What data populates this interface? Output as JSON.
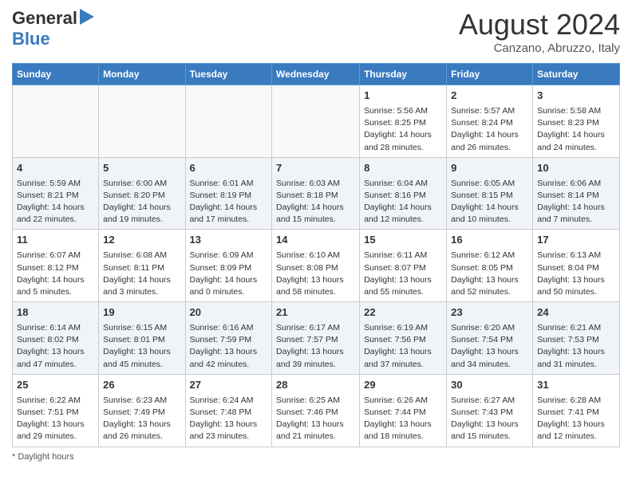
{
  "header": {
    "logo_general": "General",
    "logo_blue": "Blue",
    "month_year": "August 2024",
    "location": "Canzano, Abruzzo, Italy"
  },
  "days_of_week": [
    "Sunday",
    "Monday",
    "Tuesday",
    "Wednesday",
    "Thursday",
    "Friday",
    "Saturday"
  ],
  "weeks": [
    {
      "days": [
        {
          "num": "",
          "data": ""
        },
        {
          "num": "",
          "data": ""
        },
        {
          "num": "",
          "data": ""
        },
        {
          "num": "",
          "data": ""
        },
        {
          "num": "1",
          "data": "Sunrise: 5:56 AM\nSunset: 8:25 PM\nDaylight: 14 hours and 28 minutes."
        },
        {
          "num": "2",
          "data": "Sunrise: 5:57 AM\nSunset: 8:24 PM\nDaylight: 14 hours and 26 minutes."
        },
        {
          "num": "3",
          "data": "Sunrise: 5:58 AM\nSunset: 8:23 PM\nDaylight: 14 hours and 24 minutes."
        }
      ]
    },
    {
      "days": [
        {
          "num": "4",
          "data": "Sunrise: 5:59 AM\nSunset: 8:21 PM\nDaylight: 14 hours and 22 minutes."
        },
        {
          "num": "5",
          "data": "Sunrise: 6:00 AM\nSunset: 8:20 PM\nDaylight: 14 hours and 19 minutes."
        },
        {
          "num": "6",
          "data": "Sunrise: 6:01 AM\nSunset: 8:19 PM\nDaylight: 14 hours and 17 minutes."
        },
        {
          "num": "7",
          "data": "Sunrise: 6:03 AM\nSunset: 8:18 PM\nDaylight: 14 hours and 15 minutes."
        },
        {
          "num": "8",
          "data": "Sunrise: 6:04 AM\nSunset: 8:16 PM\nDaylight: 14 hours and 12 minutes."
        },
        {
          "num": "9",
          "data": "Sunrise: 6:05 AM\nSunset: 8:15 PM\nDaylight: 14 hours and 10 minutes."
        },
        {
          "num": "10",
          "data": "Sunrise: 6:06 AM\nSunset: 8:14 PM\nDaylight: 14 hours and 7 minutes."
        }
      ]
    },
    {
      "days": [
        {
          "num": "11",
          "data": "Sunrise: 6:07 AM\nSunset: 8:12 PM\nDaylight: 14 hours and 5 minutes."
        },
        {
          "num": "12",
          "data": "Sunrise: 6:08 AM\nSunset: 8:11 PM\nDaylight: 14 hours and 3 minutes."
        },
        {
          "num": "13",
          "data": "Sunrise: 6:09 AM\nSunset: 8:09 PM\nDaylight: 14 hours and 0 minutes."
        },
        {
          "num": "14",
          "data": "Sunrise: 6:10 AM\nSunset: 8:08 PM\nDaylight: 13 hours and 58 minutes."
        },
        {
          "num": "15",
          "data": "Sunrise: 6:11 AM\nSunset: 8:07 PM\nDaylight: 13 hours and 55 minutes."
        },
        {
          "num": "16",
          "data": "Sunrise: 6:12 AM\nSunset: 8:05 PM\nDaylight: 13 hours and 52 minutes."
        },
        {
          "num": "17",
          "data": "Sunrise: 6:13 AM\nSunset: 8:04 PM\nDaylight: 13 hours and 50 minutes."
        }
      ]
    },
    {
      "days": [
        {
          "num": "18",
          "data": "Sunrise: 6:14 AM\nSunset: 8:02 PM\nDaylight: 13 hours and 47 minutes."
        },
        {
          "num": "19",
          "data": "Sunrise: 6:15 AM\nSunset: 8:01 PM\nDaylight: 13 hours and 45 minutes."
        },
        {
          "num": "20",
          "data": "Sunrise: 6:16 AM\nSunset: 7:59 PM\nDaylight: 13 hours and 42 minutes."
        },
        {
          "num": "21",
          "data": "Sunrise: 6:17 AM\nSunset: 7:57 PM\nDaylight: 13 hours and 39 minutes."
        },
        {
          "num": "22",
          "data": "Sunrise: 6:19 AM\nSunset: 7:56 PM\nDaylight: 13 hours and 37 minutes."
        },
        {
          "num": "23",
          "data": "Sunrise: 6:20 AM\nSunset: 7:54 PM\nDaylight: 13 hours and 34 minutes."
        },
        {
          "num": "24",
          "data": "Sunrise: 6:21 AM\nSunset: 7:53 PM\nDaylight: 13 hours and 31 minutes."
        }
      ]
    },
    {
      "days": [
        {
          "num": "25",
          "data": "Sunrise: 6:22 AM\nSunset: 7:51 PM\nDaylight: 13 hours and 29 minutes."
        },
        {
          "num": "26",
          "data": "Sunrise: 6:23 AM\nSunset: 7:49 PM\nDaylight: 13 hours and 26 minutes."
        },
        {
          "num": "27",
          "data": "Sunrise: 6:24 AM\nSunset: 7:48 PM\nDaylight: 13 hours and 23 minutes."
        },
        {
          "num": "28",
          "data": "Sunrise: 6:25 AM\nSunset: 7:46 PM\nDaylight: 13 hours and 21 minutes."
        },
        {
          "num": "29",
          "data": "Sunrise: 6:26 AM\nSunset: 7:44 PM\nDaylight: 13 hours and 18 minutes."
        },
        {
          "num": "30",
          "data": "Sunrise: 6:27 AM\nSunset: 7:43 PM\nDaylight: 13 hours and 15 minutes."
        },
        {
          "num": "31",
          "data": "Sunrise: 6:28 AM\nSunset: 7:41 PM\nDaylight: 13 hours and 12 minutes."
        }
      ]
    }
  ],
  "footer": {
    "daylight_label": "Daylight hours"
  }
}
